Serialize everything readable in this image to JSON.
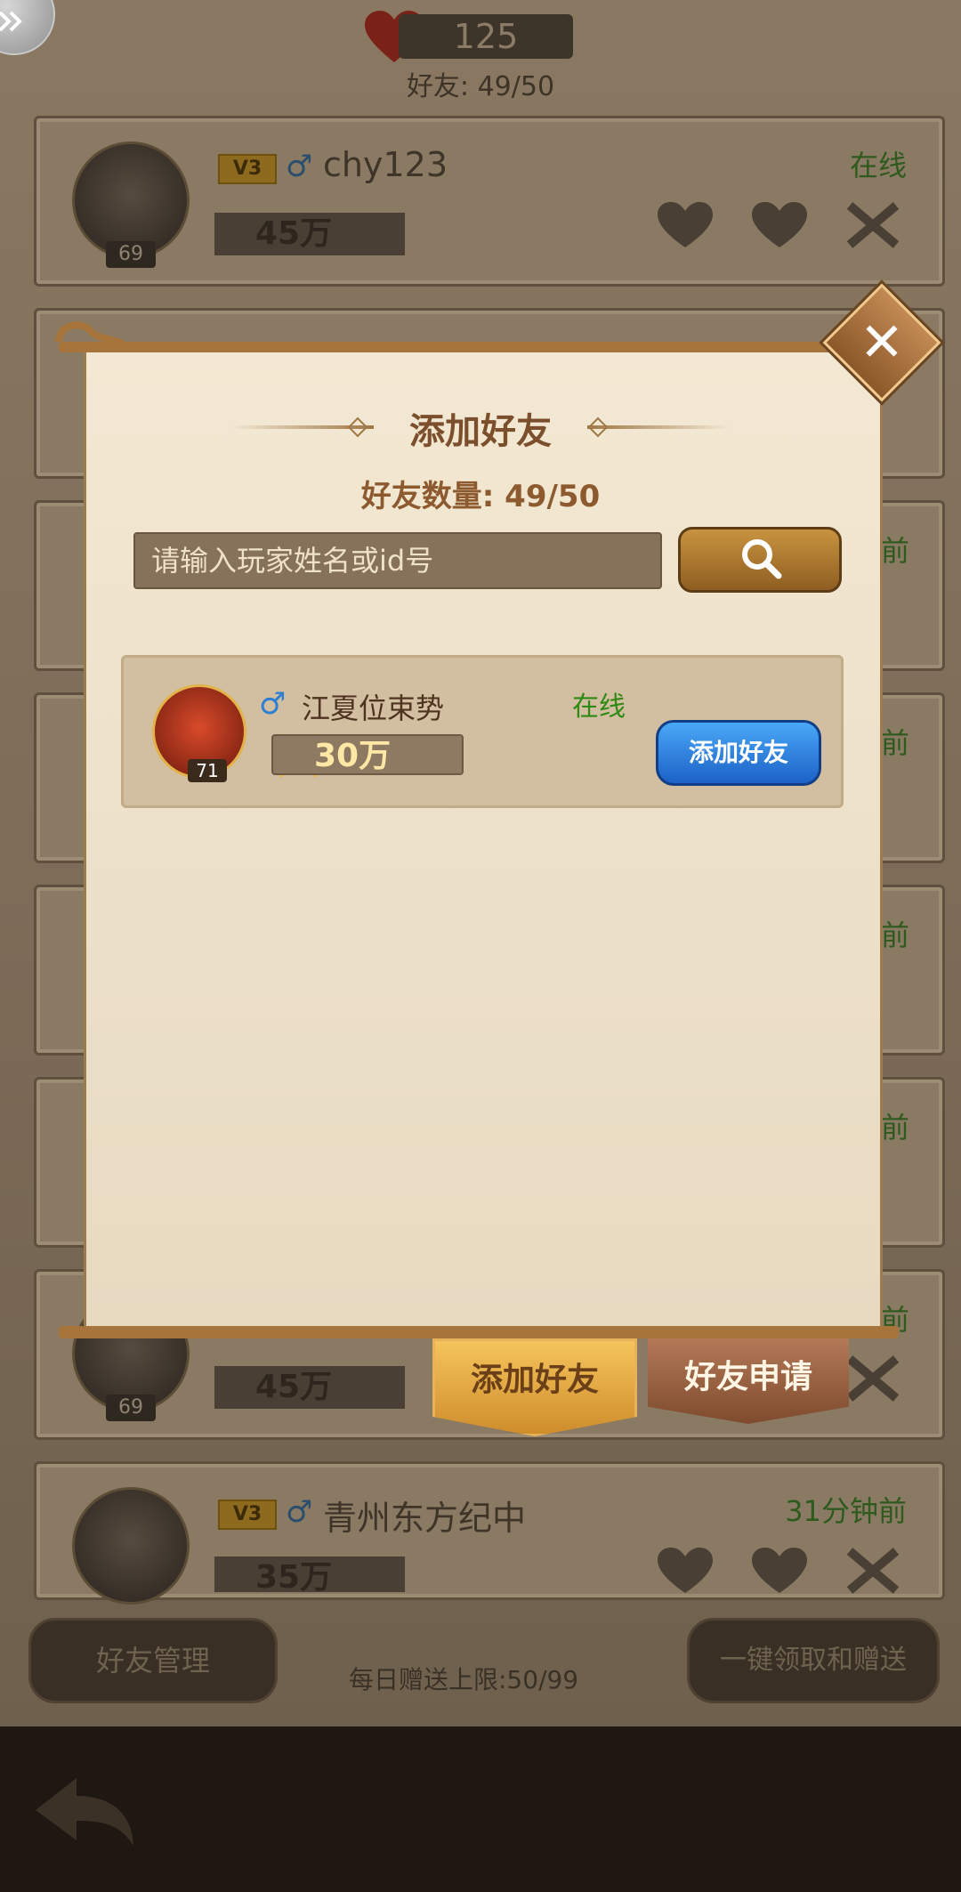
{
  "top": {
    "hearts": "125",
    "friend_count": "好友: 49/50"
  },
  "friend_rows": [
    {
      "vip": "V3",
      "gender": "♂",
      "name": "chy123",
      "status": "在线",
      "power": "45万",
      "level": "69"
    },
    {
      "vip": "",
      "gender": "",
      "name": "",
      "status": "",
      "power": "45万",
      "level": "69"
    },
    {
      "vip": "V3",
      "gender": "♂",
      "name": "青州东方纪中",
      "status": "31分钟前",
      "power": "35万",
      "level": ""
    }
  ],
  "partial_status": [
    "前",
    "前",
    "前",
    "前",
    "前"
  ],
  "bottom": {
    "manage_label": "好友管理",
    "gift_limit": "每日赠送上限:50/99",
    "claim_label": "一键领取和赠送"
  },
  "modal": {
    "title": "添加好友",
    "count": "好友数量: 49/50",
    "search_placeholder": "请输入玩家姓名或id号",
    "close_label": "✕",
    "result": {
      "gender": "♂",
      "name": "江夏位束势",
      "status": "在线",
      "power": "30万",
      "level": "71",
      "add_label": "添加好友"
    },
    "tabs": {
      "add": "添加好友",
      "requests": "好友申请"
    }
  },
  "colors": {
    "online": "#2e8a13",
    "add_button": "#1c61c7",
    "tab_active": "#f5c45c"
  }
}
